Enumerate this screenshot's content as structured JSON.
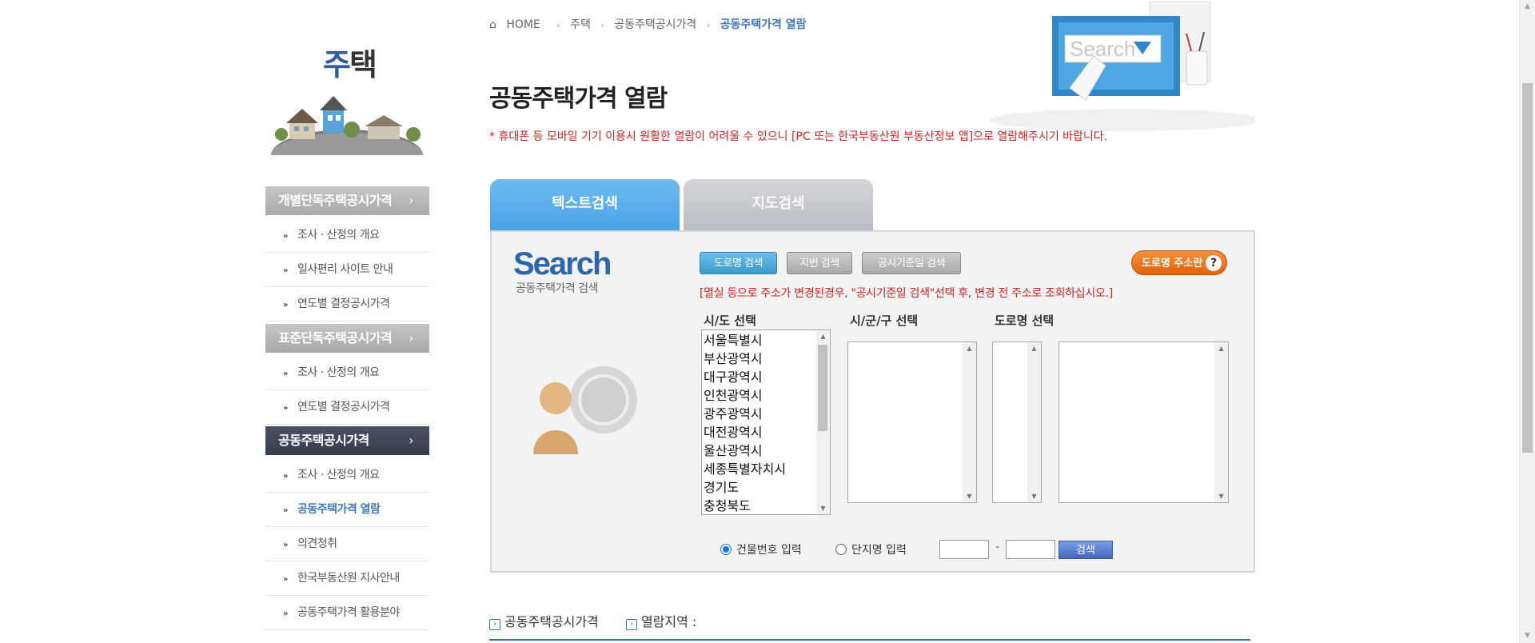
{
  "sidebar": {
    "title_a": "주",
    "title_b": "택",
    "groups": [
      {
        "header": "개별단독주택공시가격",
        "items": [
          "조사 · 산정의 개요",
          "일사편리 사이트 안내",
          "연도별 결정공시가격"
        ]
      },
      {
        "header": "표준단독주택공시가격",
        "items": [
          "조사 · 산정의 개요",
          "연도별 결정공시가격"
        ]
      },
      {
        "header": "공동주택공시가격",
        "items": [
          "조사 · 산정의 개요",
          "공동주택가격 열람",
          "의견청취",
          "한국부동산원 지사안내",
          "공동주택가격 활용분야"
        ]
      }
    ],
    "chevron": "›",
    "bullet": "»"
  },
  "breadcrumb": {
    "home": "HOME",
    "items": [
      "주택",
      "공동주택공시가격",
      "공동주택가격 열람"
    ],
    "sep": "›"
  },
  "page": {
    "title": "공동주택가격 열람",
    "notice": "* 휴대폰 등 모바일 기기 이용시 원활한 열람이 어려울 수 있으니 [PC 또는 한국부동산원 부동산정보 앱]으로 열람해주시기 바랍니다."
  },
  "hero": {
    "search_text": "Search"
  },
  "tabs": {
    "text": "텍스트검색",
    "map": "지도검색"
  },
  "search_panel": {
    "logo": "Search",
    "logo_sub": "공동주택가격 검색",
    "btn_road": "도로명 검색",
    "btn_lot": "지번 검색",
    "btn_date": "공시기준일 검색",
    "btn_addr": "도로명 주소란",
    "btn_addr_q": "?",
    "warning": "[멸실 등으로 주소가 변경된경우, \"공시기준일 검색\"선택 후, 변경 전 주소로 조회하십시오.]",
    "label_sido": "시/도 선택",
    "label_sigungu": "시/군/구 선택",
    "label_road": "도로명 선택",
    "sido": [
      "서울특별시",
      "부산광역시",
      "대구광역시",
      "인천광역시",
      "광주광역시",
      "대전광역시",
      "울산광역시",
      "세종특별자치시",
      "경기도",
      "충청북도"
    ],
    "radio_building": "건물번호 입력",
    "radio_complex": "단지명 입력",
    "dash": "-",
    "btn_search": "검색"
  },
  "bottom": {
    "link1": "공동주택공시가격",
    "link2": "열람지역 :",
    "icon": "›"
  },
  "colors": {
    "accent_blue": "#3a78c3",
    "tab_active": "#48a3e8",
    "notice_red": "#d2231f",
    "menu_active": "#353c4a",
    "addr_orange": "#e2620a"
  }
}
